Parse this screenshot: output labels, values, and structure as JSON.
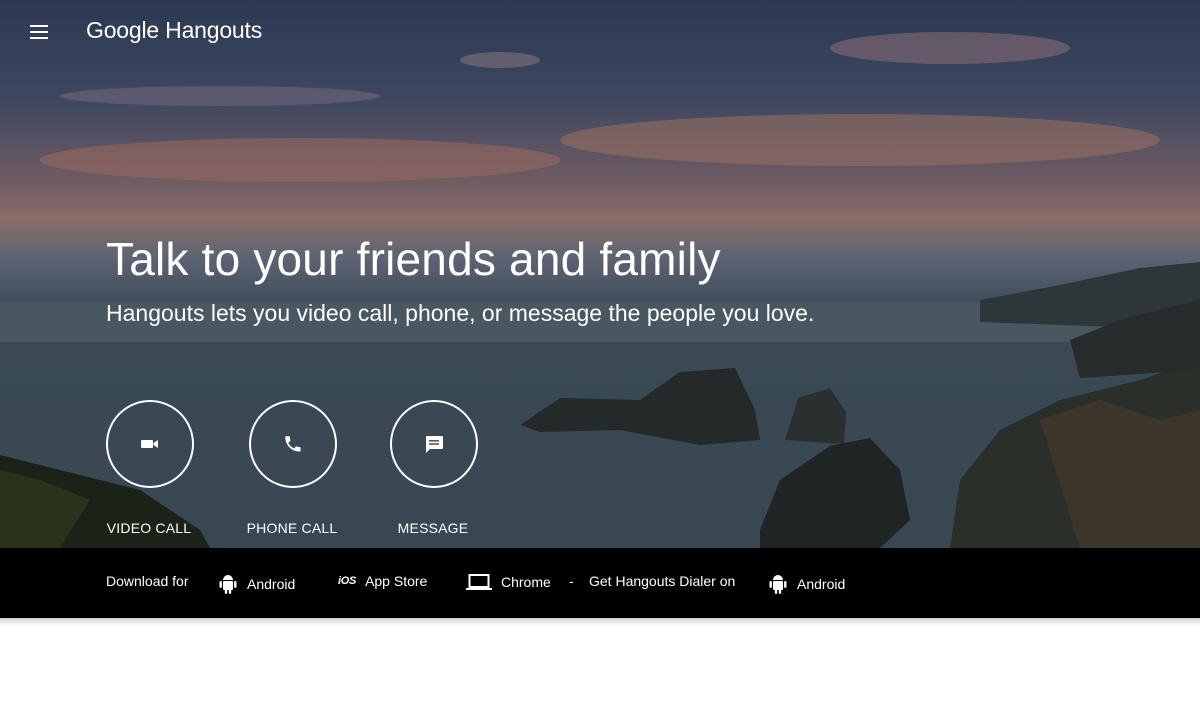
{
  "app": {
    "brand": "Google Hangouts",
    "menu_icon": "hamburger-menu-icon"
  },
  "hero": {
    "headline": "Talk to your friends and family",
    "subline": "Hangouts lets you video call, phone, or message the people you love."
  },
  "actions": [
    {
      "label": "VIDEO CALL",
      "icon": "videocam-icon"
    },
    {
      "label": "PHONE CALL",
      "icon": "phone-icon"
    },
    {
      "label": "MESSAGE",
      "icon": "message-icon"
    }
  ],
  "download_bar": {
    "prefix": "Download for",
    "android_label": "Android",
    "ios_prefix": "iOS",
    "app_store_label": "App Store",
    "chrome_label": "Chrome",
    "separator": "-",
    "dialer_text": "Get Hangouts Dialer on",
    "dialer_android_label": "Android"
  },
  "colors": {
    "bar_background": "#000000",
    "text": "#ffffff",
    "page_background": "#ffffff"
  }
}
